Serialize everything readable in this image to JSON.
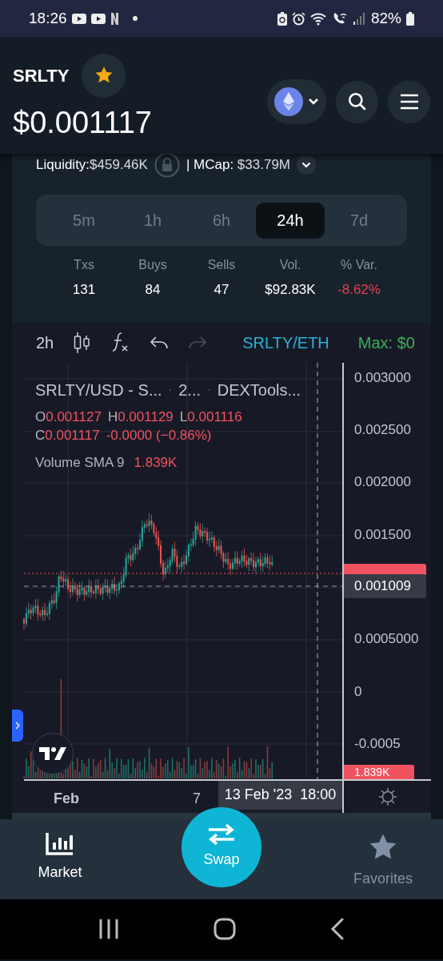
{
  "status_bar": {
    "time": "18:26",
    "battery": "82%"
  },
  "token": {
    "symbol": "SRLTY",
    "favorite": true,
    "price": "$0.001117"
  },
  "info": {
    "liquidity_label": "Liquidity:",
    "liquidity": "$459.46K",
    "mcap_label": "| MCap:",
    "mcap": "$33.79M"
  },
  "periods": [
    {
      "label": "5m",
      "selected": false
    },
    {
      "label": "1h",
      "selected": false
    },
    {
      "label": "6h",
      "selected": false
    },
    {
      "label": "24h",
      "selected": true
    },
    {
      "label": "7d",
      "selected": false
    }
  ],
  "stats": [
    {
      "label": "Txs",
      "value": "131",
      "kind": "plain"
    },
    {
      "label": "Buys",
      "value": "84",
      "kind": "plain"
    },
    {
      "label": "Sells",
      "value": "47",
      "kind": "plain"
    },
    {
      "label": "Vol.",
      "value": "$92.83K",
      "kind": "plain"
    },
    {
      "label": "% Var.",
      "value": "-8.62%",
      "kind": "negative"
    }
  ],
  "chart_toolbar": {
    "interval": "2h",
    "pair": "SRLTY/ETH",
    "max": "Max: $0"
  },
  "legend": {
    "parts": [
      "SRLTY/USD - S...",
      "2...",
      "DEXTools..."
    ],
    "separator": "·",
    "ohlc": [
      {
        "label": "O",
        "value": "0.001127"
      },
      {
        "label": "H",
        "value": "0.001129"
      },
      {
        "label": "L",
        "value": "0.001116"
      },
      {
        "label": "C",
        "value": "0.001117"
      }
    ],
    "change": "-0.0000 (−0.86%)",
    "volume_label": "Volume SMA 9",
    "volume_value": "1.839K"
  },
  "price_axis": [
    "0.003000",
    "0.002500",
    "0.002000",
    "0.001500",
    "0.0005000",
    "0",
    "-0.0005"
  ],
  "crosshair_price": "0.001009",
  "volume_tag": "1.839K",
  "time_axis": {
    "labels": [
      "Feb",
      "7"
    ],
    "crosshair_time": "13 Feb '23  18:00"
  },
  "bottom_nav": {
    "items": [
      {
        "label": "Market",
        "selected": true
      },
      {
        "label": "Favorites",
        "selected": false
      }
    ],
    "swap": "Swap"
  }
}
